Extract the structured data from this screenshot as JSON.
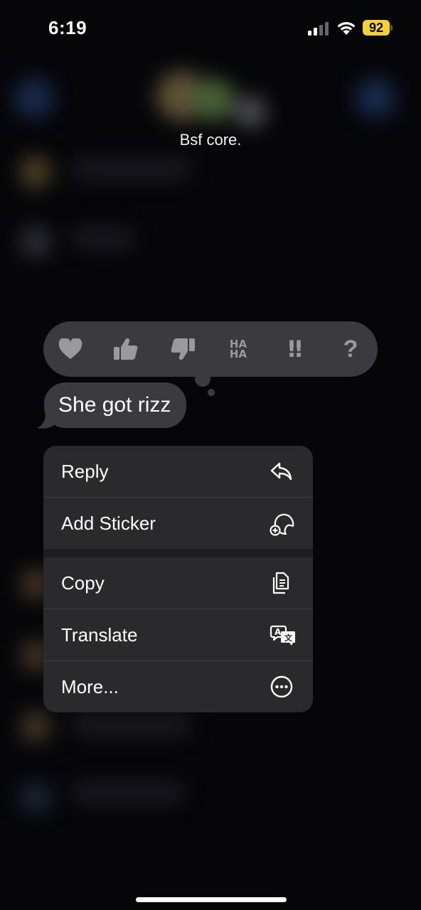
{
  "status_bar": {
    "time": "6:19",
    "battery_percent": "92",
    "battery_color": "#f2d22e"
  },
  "chat": {
    "title": "Bsf core."
  },
  "reactions": [
    {
      "name": "heart",
      "icon": "heart-icon"
    },
    {
      "name": "thumbs-up",
      "icon": "thumbs-up-icon"
    },
    {
      "name": "thumbs-down",
      "icon": "thumbs-down-icon"
    },
    {
      "name": "haha",
      "icon": "haha-icon",
      "label_top": "HA",
      "label_bottom": "HA"
    },
    {
      "name": "emphasize",
      "icon": "double-exclamation-icon",
      "label": "‼"
    },
    {
      "name": "question",
      "icon": "question-icon",
      "label": "?"
    }
  ],
  "message": {
    "text": "She got rizz"
  },
  "context_menu": {
    "items": [
      {
        "label": "Reply",
        "icon": "reply-icon"
      },
      {
        "label": "Add Sticker",
        "icon": "sticker-icon"
      },
      {
        "label": "Copy",
        "icon": "copy-icon"
      },
      {
        "label": "Translate",
        "icon": "translate-icon"
      },
      {
        "label": "More...",
        "icon": "more-icon"
      }
    ]
  },
  "colors": {
    "background": "#060609",
    "reaction_icon": "#9a9a9e",
    "menu_background": "#2a2a2d",
    "bubble": "#3b3b3f"
  }
}
